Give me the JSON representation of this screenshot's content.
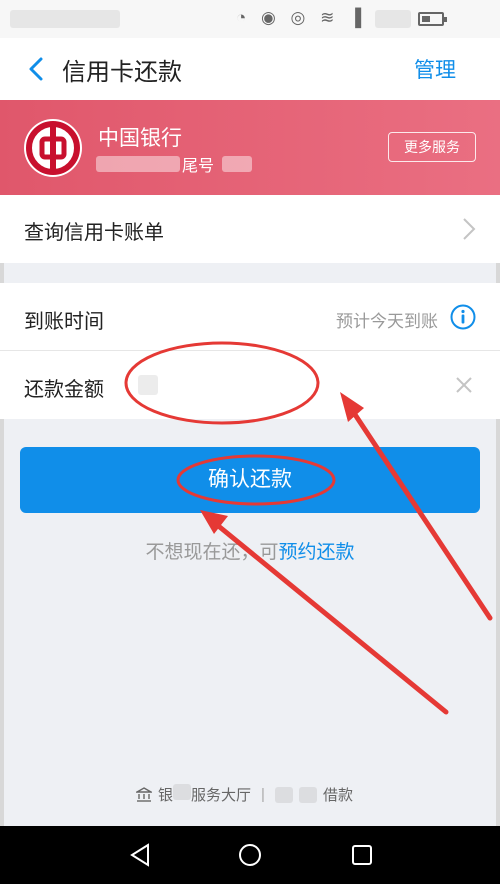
{
  "nav": {
    "title": "信用卡还款",
    "manage_label": "管理"
  },
  "bank": {
    "name": "中国银行",
    "tail_label": "尾号",
    "more_services_label": "更多服务",
    "brand_color": "#e0576b"
  },
  "bill_row": {
    "label": "查询信用卡账单"
  },
  "arrival_row": {
    "label": "到账时间",
    "value": "预计今天到账"
  },
  "amount_row": {
    "label": "还款金额",
    "value": ""
  },
  "confirm_label": "确认还款",
  "schedule": {
    "prefix": "不想现在还，可",
    "link": "预约还款"
  },
  "footer": {
    "bank_hall_label": "服务大厅",
    "bank_hall_prefix": "银",
    "loan_label": "借款"
  },
  "colors": {
    "accent": "#108ee9",
    "annotation": "#e53935"
  },
  "icons": {
    "back": "chevron-left-icon",
    "info": "info-circle-icon",
    "clear": "close-icon",
    "chevron": "chevron-right-icon",
    "bank_logo": "bank-of-china-logo"
  }
}
